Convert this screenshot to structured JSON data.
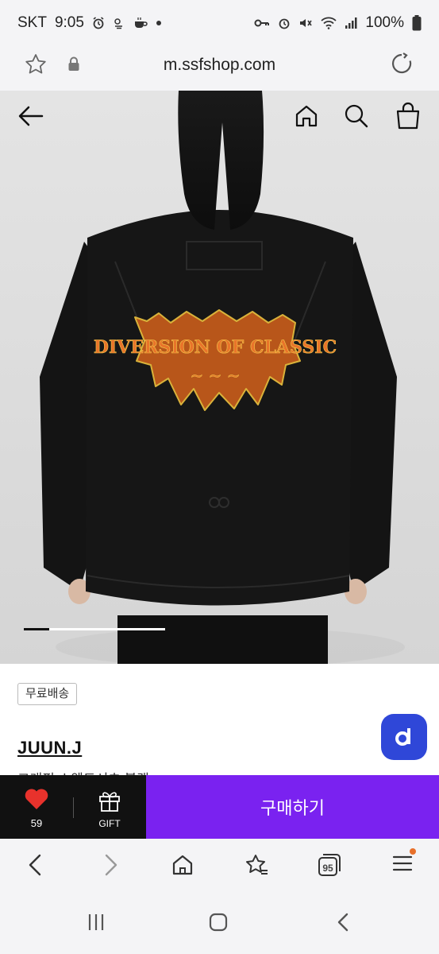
{
  "status_bar": {
    "carrier": "SKT",
    "time": "9:05",
    "battery": "100%",
    "icons_left": [
      "alarm-icon",
      "weather-icon",
      "coffee-icon",
      "dot-icon"
    ],
    "icons_right": [
      "key-icon",
      "alarm-icon",
      "mute-icon",
      "wifi-icon",
      "signal-icon",
      "battery-icon"
    ]
  },
  "url_bar": {
    "url": "m.ssfshop.com"
  },
  "hero": {
    "nav_icons": [
      "back-arrow-icon",
      "home-icon",
      "search-icon",
      "shopping-bag-icon"
    ],
    "image_text": "DIVERSION OF CLASSIC",
    "slide_progress": 0.18
  },
  "product": {
    "free_shipping_tag": "무료배송",
    "brand": "JUUN.J",
    "name_partial": "그래픽 스웨트셔츠 블랙"
  },
  "action_bar": {
    "like_count": "59",
    "gift_label": "GIFT",
    "buy_label": "구매하기"
  },
  "colors": {
    "buy_button": "#7a22f0",
    "action_bar_left": "#111111",
    "heart": "#e8322c",
    "chat_fab": "#2f47d8",
    "menu_badge": "#e8702a"
  },
  "browser_toolbar": {
    "tabs_count": "95",
    "icons": [
      "back-icon",
      "forward-icon",
      "home-icon",
      "bookmarks-icon",
      "tabs-icon",
      "menu-icon"
    ]
  },
  "system_nav": {
    "icons": [
      "recents-icon",
      "home-icon",
      "back-icon"
    ]
  }
}
